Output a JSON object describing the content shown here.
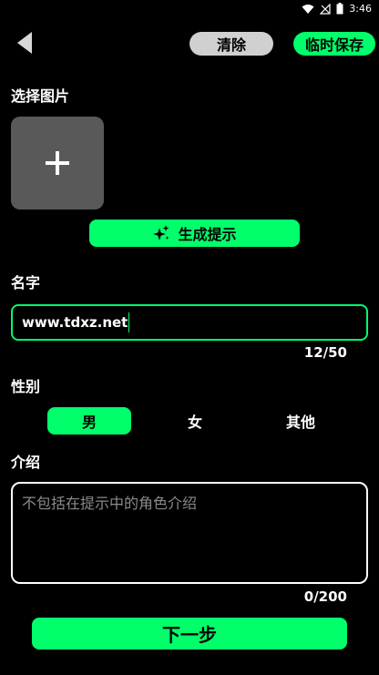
{
  "status_bar": {
    "time": "3:46"
  },
  "top_bar": {
    "clear_label": "清除",
    "save_label": "临时保存"
  },
  "image_section": {
    "label": "选择图片"
  },
  "generate_button": {
    "label": "生成提示"
  },
  "name_section": {
    "label": "名字",
    "value": "www.tdxz.net",
    "counter": "12/50"
  },
  "gender_section": {
    "label": "性别",
    "options": [
      "男",
      "女",
      "其他"
    ],
    "selected_index": 0
  },
  "intro_section": {
    "label": "介绍",
    "placeholder": "不包括在提示中的角色介绍",
    "counter": "0/200"
  },
  "next_button": {
    "label": "下一步"
  },
  "colors": {
    "accent": "#00ff6a",
    "background": "#000000",
    "chip_gray": "#d0d0d0",
    "picker_gray": "#595959"
  },
  "icons": [
    "wifi-icon",
    "signal-icon",
    "battery-icon",
    "back-arrow-icon",
    "plus-icon",
    "sparkle-icon"
  ]
}
